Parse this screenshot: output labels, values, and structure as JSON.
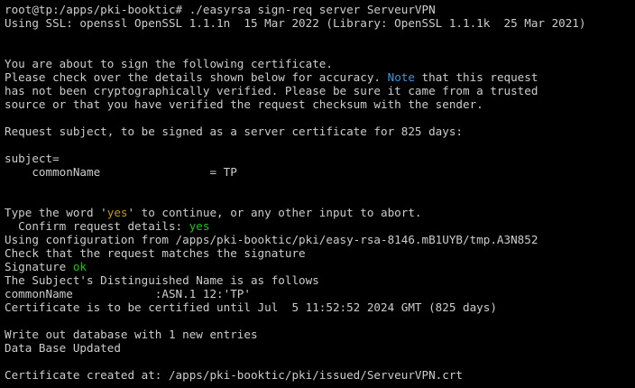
{
  "terminal": {
    "lines": [
      {
        "segments": [
          {
            "text": "root@tp:/apps/pki-booktic# ./easyrsa sign-req server ServeurVPN"
          }
        ]
      },
      {
        "segments": [
          {
            "text": "Using SSL: openssl OpenSSL 1.1.1n  15 Mar 2022 (Library: OpenSSL 1.1.1k  25 Mar 2021)"
          }
        ]
      },
      {
        "segments": [
          {
            "text": ""
          }
        ]
      },
      {
        "segments": [
          {
            "text": ""
          }
        ]
      },
      {
        "segments": [
          {
            "text": "You are about to sign the following certificate."
          }
        ]
      },
      {
        "segments": [
          {
            "text": "Please check over the details shown below for accuracy. "
          },
          {
            "text": "Note",
            "color": "blue"
          },
          {
            "text": " that this request"
          }
        ]
      },
      {
        "segments": [
          {
            "text": "has not been cryptographically verified. Please be sure it came from a trusted"
          }
        ]
      },
      {
        "segments": [
          {
            "text": "source or that you have verified the request checksum with the sender."
          }
        ]
      },
      {
        "segments": [
          {
            "text": ""
          }
        ]
      },
      {
        "segments": [
          {
            "text": "Request subject, to be signed as a server certificate for 825 days:"
          }
        ]
      },
      {
        "segments": [
          {
            "text": ""
          }
        ]
      },
      {
        "segments": [
          {
            "text": "subject="
          }
        ]
      },
      {
        "segments": [
          {
            "text": "    commonName                = TP"
          }
        ]
      },
      {
        "segments": [
          {
            "text": ""
          }
        ]
      },
      {
        "segments": [
          {
            "text": ""
          }
        ]
      },
      {
        "segments": [
          {
            "text": "Type the word '"
          },
          {
            "text": "yes",
            "color": "yellow"
          },
          {
            "text": "' to continue, or any other input to abort."
          }
        ]
      },
      {
        "segments": [
          {
            "text": "  Confirm request details: "
          },
          {
            "text": "yes",
            "color": "green"
          }
        ]
      },
      {
        "segments": [
          {
            "text": "Using configuration from /apps/pki-booktic/pki/easy-rsa-8146.mB1UYB/tmp.A3N852"
          }
        ]
      },
      {
        "segments": [
          {
            "text": "Check that the request matches the signature"
          }
        ]
      },
      {
        "segments": [
          {
            "text": "Signature "
          },
          {
            "text": "ok",
            "color": "green"
          }
        ]
      },
      {
        "segments": [
          {
            "text": "The Subject's Distinguished Name is as follows"
          }
        ]
      },
      {
        "segments": [
          {
            "text": "commonName            :ASN.1 12:'TP'"
          }
        ]
      },
      {
        "segments": [
          {
            "text": "Certificate is to be certified until Jul  5 11:52:52 2024 GMT (825 days)"
          }
        ]
      },
      {
        "segments": [
          {
            "text": ""
          }
        ]
      },
      {
        "segments": [
          {
            "text": "Write out database with 1 new entries"
          }
        ]
      },
      {
        "segments": [
          {
            "text": "Data Base Updated"
          }
        ]
      },
      {
        "segments": [
          {
            "text": ""
          }
        ]
      },
      {
        "segments": [
          {
            "text": "Certificate created at: /apps/pki-booktic/pki/issued/ServeurVPN.crt"
          }
        ]
      }
    ]
  },
  "colors": {
    "background": "#000000",
    "foreground": "#cccccc",
    "blue": "#3a96dd",
    "green": "#16c60c",
    "yellow": "#c19c00"
  }
}
